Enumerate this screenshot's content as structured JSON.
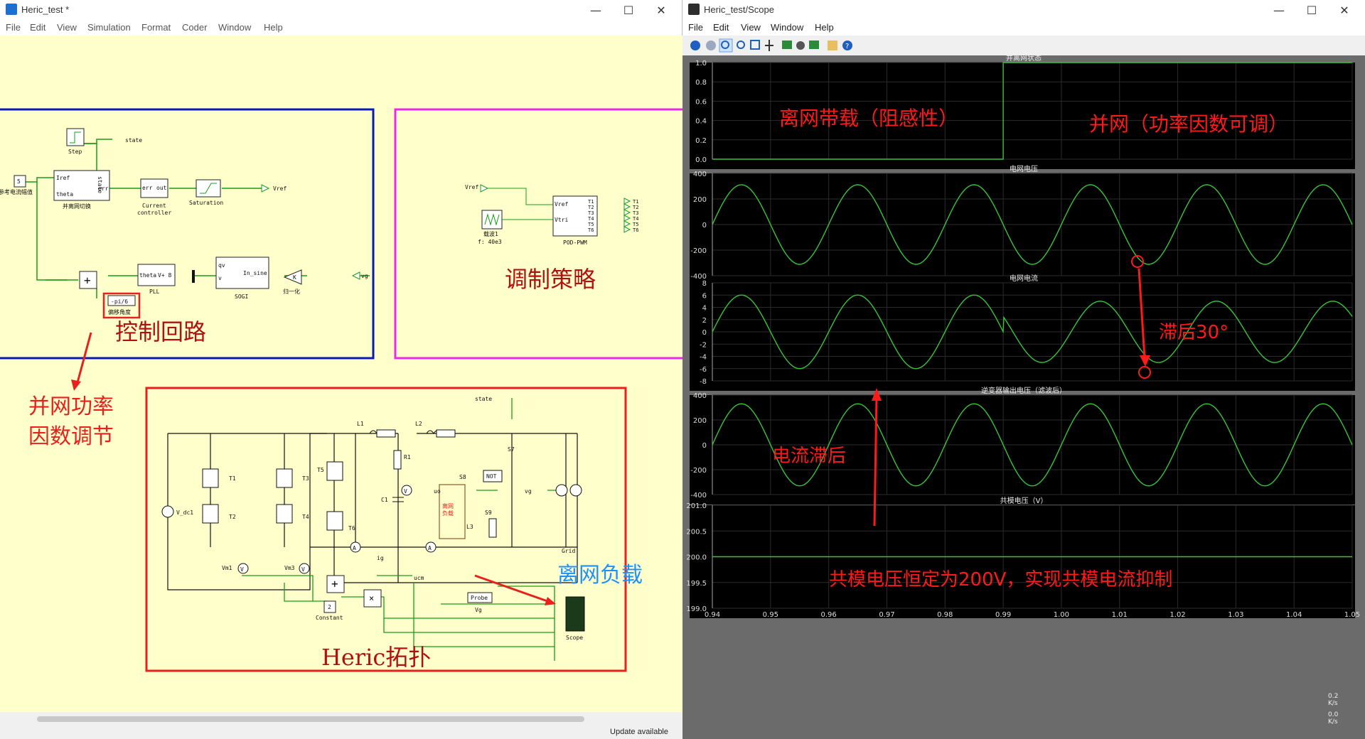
{
  "left_window": {
    "title": "Heric_test *",
    "menu": [
      "File",
      "Edit",
      "View",
      "Simulation",
      "Format",
      "Coder",
      "Window",
      "Help"
    ],
    "status": "Update available"
  },
  "right_window": {
    "title": "Heric_test/Scope",
    "menu": [
      "File",
      "Edit",
      "View",
      "Window",
      "Help"
    ]
  },
  "schematic": {
    "blocks": {
      "step": "Step",
      "state_out": "state",
      "ref_const": "5",
      "ref_label": "参考电流幅值",
      "switch_in_iref": "Iref",
      "switch_in_theta": "theta",
      "switch_state": "state",
      "switch_err": "err",
      "switch_label": "并离网切换",
      "cc_in": "err",
      "cc_out": "out",
      "cc_label1": "Current",
      "cc_label2": "controller",
      "sat_label": "Saturation",
      "vref_out": "Vref",
      "pll_in": "theta",
      "pll_out": "V+ 8",
      "pll_label": "PLL",
      "sogi_qv": "qv",
      "sogi_v": "v",
      "sogi_out": "In_sine",
      "sogi_label": "SOGI",
      "gain": "K",
      "gain_label": "归一化",
      "vg_in": "vg",
      "offset_const": "-pi/6",
      "offset_label": "偏移角度",
      "pwm_vref_in": "Vref",
      "pwm_in1": "Vref",
      "pwm_in2": "Vtri",
      "pwm_outs": [
        "T1",
        "T2",
        "T3",
        "T4",
        "T5",
        "T6"
      ],
      "pwm_label": "POD-PWM",
      "carrier_label": "载波1",
      "carrier_freq": "f: 40e3"
    },
    "circuit": {
      "l1": "L1",
      "l2": "L2",
      "r1": "R1",
      "c1": "C1",
      "t1": "T1",
      "t2": "T2",
      "t3": "T3",
      "t4": "T4",
      "t5": "T5",
      "t6": "T6",
      "s7": "S7",
      "s8": "S8",
      "s9": "S9",
      "not": "NOT",
      "vdc": "V_dc1",
      "state": "state",
      "vg": "vg",
      "grid": "Grid",
      "ig": "ig",
      "uo": "uo",
      "ucm": "ucm",
      "l3": "L3",
      "load": "离网\n负载",
      "vm1": "Vm1",
      "vm3": "Vm3",
      "const2": "2",
      "const2_label": "Constant",
      "probe": "Probe",
      "probe_vg": "Vg",
      "scope": "Scope"
    },
    "annotations": {
      "control_loop": "控制回路",
      "modulation": "调制策略",
      "grid_power": "并网功率\n因数调节",
      "offgrid_load": "离网负载",
      "topology": "Heric拓扑"
    },
    "colors": {
      "canvas_bg": "#ffffcc",
      "control_box": "#0a1ab3",
      "modulation_box": "#e82be8",
      "topology_box": "#e8201e",
      "wire": "#1a9c1a"
    }
  },
  "scope": {
    "x_ticks": [
      "0.94",
      "0.95",
      "0.96",
      "0.97",
      "0.98",
      "0.99",
      "1.00",
      "1.01",
      "1.02",
      "1.03",
      "1.04",
      "1.05"
    ],
    "plots": [
      {
        "title": "并离网状态",
        "y_ticks": [
          "1.0",
          "0.8",
          "0.6",
          "0.4",
          "0.2",
          "0.0"
        ],
        "ylim": [
          0,
          1
        ],
        "note_left": "离网带载（阻感性）",
        "note_right": "并网（功率因数可调）"
      },
      {
        "title": "电网电压",
        "y_ticks": [
          "400",
          "200",
          "0",
          "-200",
          "-400"
        ],
        "ylim": [
          -400,
          400
        ],
        "note": ""
      },
      {
        "title": "电网电流",
        "y_ticks": [
          "8",
          "6",
          "4",
          "2",
          "0",
          "-2",
          "-4",
          "-6",
          "-8"
        ],
        "ylim": [
          -8,
          8
        ],
        "note_lag30": "滞后30°",
        "note_lag": "电流滞后"
      },
      {
        "title": "逆变器输出电压（滤波后）",
        "y_ticks": [
          "400",
          "200",
          "0",
          "-200",
          "-400"
        ],
        "ylim": [
          -400,
          400
        ]
      },
      {
        "title": "共模电压（V）",
        "y_ticks": [
          "201.0",
          "200.5",
          "200.0",
          "199.5",
          "199.0"
        ],
        "ylim": [
          199,
          201
        ],
        "note": "共模电压恒定为200V，实现共模电流抑制"
      }
    ],
    "side_readouts": [
      "0.2",
      "K/s",
      "0.0",
      "K/s"
    ]
  },
  "chart_data": [
    {
      "type": "line",
      "title": "并离网状态",
      "x": [
        0.94,
        0.99,
        0.99,
        1.05
      ],
      "series": [
        {
          "values": [
            0,
            0,
            1,
            1
          ]
        }
      ],
      "xlim": [
        0.94,
        1.05
      ],
      "ylim": [
        0,
        1
      ],
      "grid": true
    },
    {
      "type": "line",
      "title": "电网电压",
      "x_function": "sine 50 Hz",
      "amplitude": 311,
      "peak_time": 0.945,
      "xlim": [
        0.94,
        1.05
      ],
      "ylim": [
        -400,
        400
      ],
      "grid": true
    },
    {
      "type": "line",
      "title": "电网电流",
      "x_function": "sine 50 Hz",
      "amplitude_before": 6,
      "amplitude_after": 5,
      "lag_after_switch_deg": 30,
      "switch_time": 0.99,
      "xlim": [
        0.94,
        1.05
      ],
      "ylim": [
        -8,
        8
      ],
      "grid": true
    },
    {
      "type": "line",
      "title": "逆变器输出电压（滤波后）",
      "x_function": "sine 50 Hz",
      "amplitude": 330,
      "xlim": [
        0.94,
        1.05
      ],
      "ylim": [
        -400,
        400
      ],
      "grid": true
    },
    {
      "type": "line",
      "title": "共模电压（V）",
      "x": [
        0.94,
        1.05
      ],
      "series": [
        {
          "values": [
            200,
            200
          ]
        }
      ],
      "xlim": [
        0.94,
        1.05
      ],
      "ylim": [
        199,
        201
      ],
      "grid": true
    }
  ]
}
